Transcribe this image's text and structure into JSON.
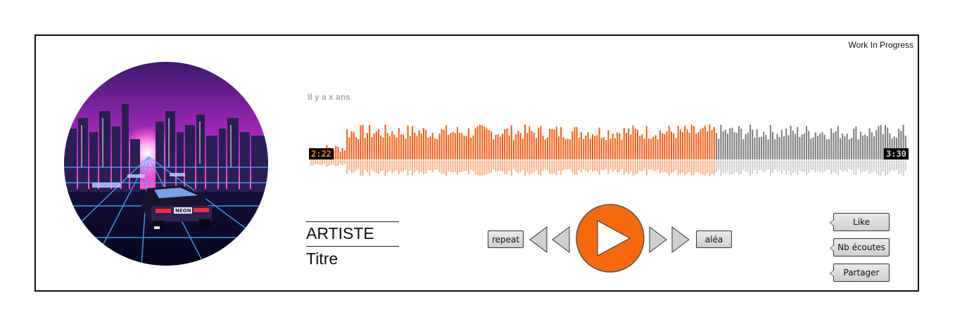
{
  "status": {
    "label": "Work In Progress"
  },
  "track": {
    "posted_ago": "Il y a x ans",
    "artist": "ARTISTE",
    "title": "Titre",
    "current_time": "2:22",
    "total_time": "3:30",
    "progress": 0.676
  },
  "controls": {
    "repeat_label": "repeat",
    "shuffle_label": "aléa"
  },
  "actions": {
    "like_label": "Like",
    "listens_label": "Nb écoutes",
    "share_label": "Partager"
  },
  "colors": {
    "accent": "#f56a0f",
    "played": "#ff5a10",
    "unplayed": "#7a7a7a",
    "play_button": "#f56a0f"
  },
  "icons": {
    "cover": "neon-city-car-artwork",
    "prev": "previous-double-triangle-icon",
    "play": "play-icon",
    "next": "next-double-triangle-icon"
  }
}
